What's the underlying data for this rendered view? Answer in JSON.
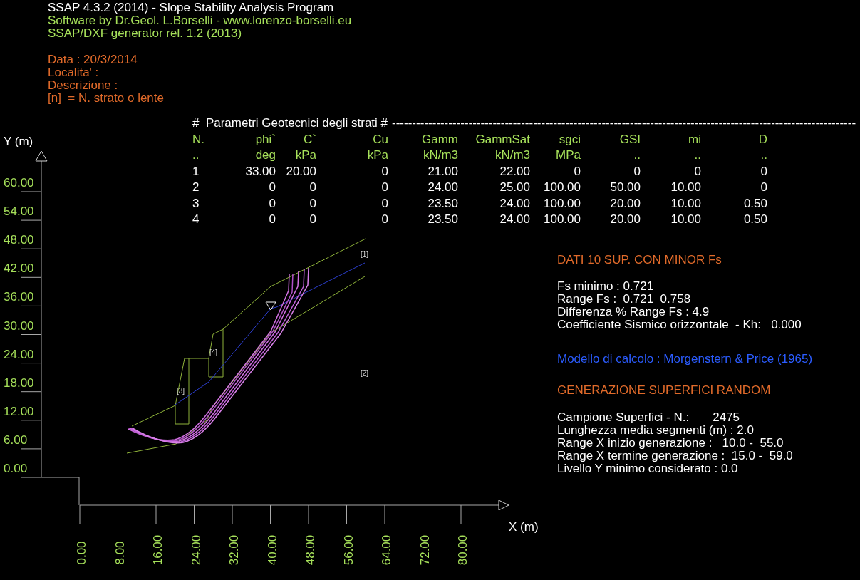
{
  "header": {
    "title": "SSAP 4.3.2 (2014) - Slope Stability Analysis Program",
    "credits": "Software by Dr.Geol. L.Borselli - www.lorenzo-borselli.eu",
    "generator": "SSAP/DXF generator rel. 1.2 (2013)"
  },
  "project": [
    "Data : 20/3/2014",
    "Localita' :",
    "Descrizione :",
    "[n]  = N. strato o lente"
  ],
  "params_table": {
    "title": "#  Parametri Geotecnici degli strati #",
    "rule": "-------------------------------------------------------------------------------------------------------------------",
    "columns": [
      {
        "name": "N.",
        "unit": ".."
      },
      {
        "name": "phi`",
        "unit": "deg"
      },
      {
        "name": "C`",
        "unit": "kPa"
      },
      {
        "name": "Cu",
        "unit": "kPa"
      },
      {
        "name": "Gamm",
        "unit": "kN/m3"
      },
      {
        "name": "GammSat",
        "unit": "kN/m3"
      },
      {
        "name": "sgci",
        "unit": "MPa"
      },
      {
        "name": "GSI",
        "unit": ".."
      },
      {
        "name": "mi",
        "unit": ".."
      },
      {
        "name": "D",
        "unit": ".."
      }
    ],
    "rows": [
      [
        "1",
        "33.00",
        "20.00",
        "0",
        "21.00",
        "22.00",
        "0",
        "0",
        "0",
        "0"
      ],
      [
        "2",
        "0",
        "0",
        "0",
        "24.00",
        "25.00",
        "100.00",
        "50.00",
        "10.00",
        "0"
      ],
      [
        "3",
        "0",
        "0",
        "0",
        "23.50",
        "24.00",
        "100.00",
        "20.00",
        "10.00",
        "0.50"
      ],
      [
        "4",
        "0",
        "0",
        "0",
        "23.50",
        "24.00",
        "100.00",
        "20.00",
        "10.00",
        "0.50"
      ]
    ]
  },
  "results": {
    "title": "DATI 10 SUP. CON MINOR Fs",
    "lines": [
      "Fs minimo : 0.721",
      "Range Fs :  0.721  0.758",
      "Differenza % Range Fs : 4.9",
      "Coefficiente Sismico orizzontale  - Kh:   0.000"
    ],
    "model": "Modello di calcolo : Morgenstern & Price (1965)",
    "generation_title": "GENERAZIONE SUPERFICI RANDOM",
    "generation_lines": [
      "Campione Superfici - N.:       2475",
      "Lunghezza media segmenti (m) : 2.0",
      "Range X inizio generazione :   10.0 -  55.0",
      "Range X termine generazione :  15.0 -  59.0",
      "Livello Y minimo considerato : 0.0"
    ]
  },
  "plot": {
    "y_label": "Y (m)",
    "y_ticks": [
      "60.00",
      "54.00",
      "48.00",
      "42.00",
      "36.00",
      "30.00",
      "24.00",
      "18.00",
      "12.00",
      "6.00",
      "0.00"
    ],
    "x_label": "X (m)",
    "x_ticks": [
      "0.00",
      "8.00",
      "16.00",
      "24.00",
      "32.00",
      "40.00",
      "48.00",
      "56.00",
      "64.00",
      "72.00",
      "80.00"
    ],
    "layer_labels": [
      "[1]",
      "[2]",
      "[3]",
      "[4]"
    ]
  }
}
